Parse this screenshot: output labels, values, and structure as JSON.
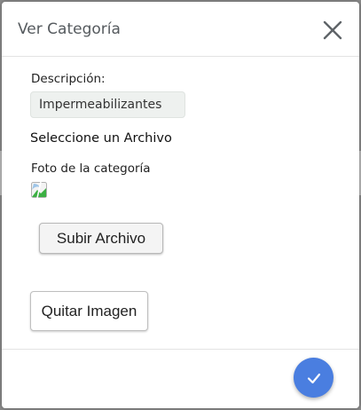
{
  "modal": {
    "title": "Ver Categoría",
    "close_icon": "close-icon"
  },
  "form": {
    "description_label": "Descripción:",
    "description_value": "Impermeabilizantes",
    "select_file_text": "Seleccione un Archivo",
    "photo_label": "Foto de la categoría",
    "photo_icon": "broken-image-icon",
    "upload_button_label": "Subir Archivo",
    "remove_image_button_label": "Quitar Imagen"
  },
  "footer": {
    "confirm_icon": "check-icon"
  },
  "colors": {
    "confirm_button": "#4a7ee0",
    "title_text": "#555a5e",
    "description_field_bg": "#eef1ef"
  }
}
